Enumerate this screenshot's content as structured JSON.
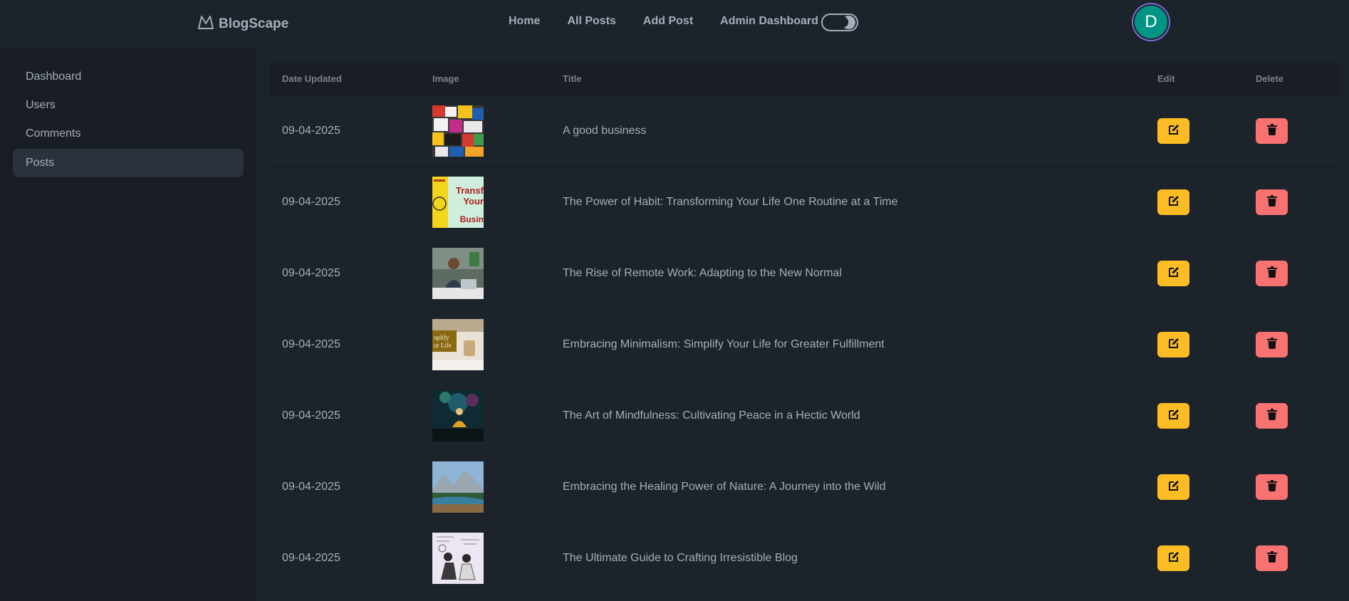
{
  "brand": {
    "name": "BlogScape",
    "logo_icon": "mountain-icon"
  },
  "nav": {
    "links": [
      "Home",
      "All Posts",
      "Add Post",
      "Admin Dashboard"
    ],
    "theme_toggle": "theme-toggle"
  },
  "user": {
    "initial": "D"
  },
  "sidebar": {
    "items": [
      {
        "label": "Dashboard",
        "active": false
      },
      {
        "label": "Users",
        "active": false
      },
      {
        "label": "Comments",
        "active": false
      },
      {
        "label": "Posts",
        "active": true
      }
    ]
  },
  "table": {
    "headers": [
      "Date Updated",
      "Image",
      "Title",
      "Edit",
      "Delete"
    ],
    "rows": [
      {
        "date": "09-04-2025",
        "title": "A good business"
      },
      {
        "date": "09-04-2025",
        "title": "The Power of Habit: Transforming Your Life One Routine at a Time"
      },
      {
        "date": "09-04-2025",
        "title": "The Rise of Remote Work: Adapting to the New Normal"
      },
      {
        "date": "09-04-2025",
        "title": "Embracing Minimalism: Simplify Your Life for Greater Fulfillment"
      },
      {
        "date": "09-04-2025",
        "title": "The Art of Mindfulness: Cultivating Peace in a Hectic World"
      },
      {
        "date": "09-04-2025",
        "title": "Embracing the Healing Power of Nature: A Journey into the Wild"
      },
      {
        "date": "09-04-2025",
        "title": "The Ultimate Guide to Crafting Irresistible Blog"
      }
    ]
  },
  "thumb_texts": {
    "habit": [
      "Transf",
      "Your",
      "Busin"
    ],
    "minimalism": [
      "nplify",
      "ur Life"
    ]
  },
  "colors": {
    "background": "#1d232a",
    "sidebar": "#191e24",
    "active_item": "#2a323c",
    "edit_button": "#fbbd23",
    "delete_button": "#f87272",
    "avatar_ring": "#7c6bd8",
    "avatar_fill": "#009485"
  }
}
